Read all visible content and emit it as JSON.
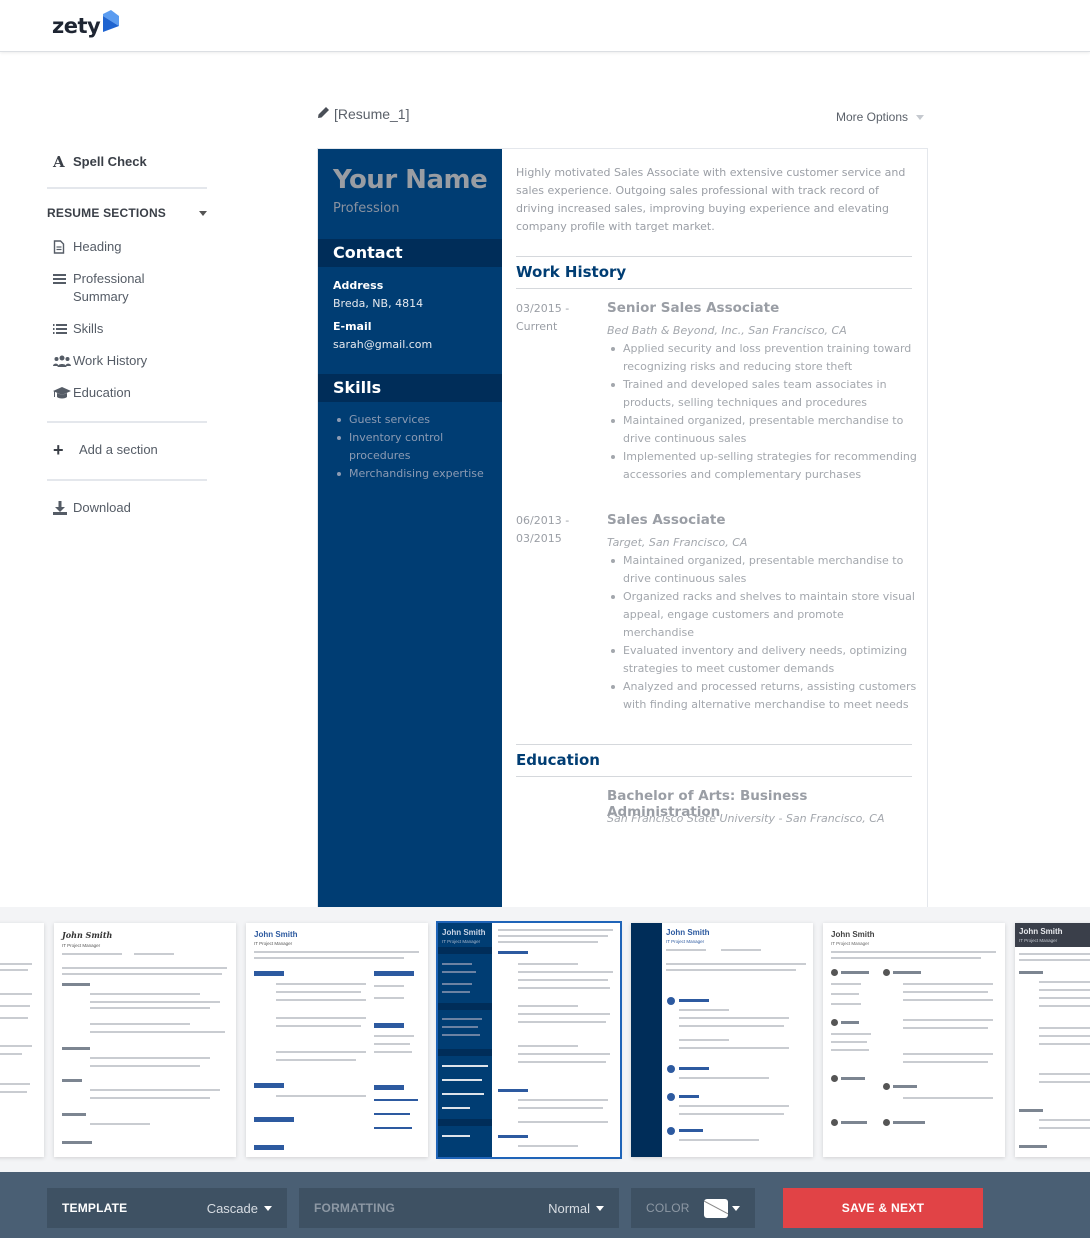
{
  "app": {
    "logo_text": "zety",
    "brand_color": "#2a7de1"
  },
  "sidebar": {
    "spell_check": "Spell Check",
    "sections_header": "RESUME SECTIONS",
    "sections": [
      {
        "label": "Heading",
        "icon": "document-icon"
      },
      {
        "label": "Professional Summary",
        "icon": "lines-icon"
      },
      {
        "label": "Skills",
        "icon": "numbered-list-icon"
      },
      {
        "label": "Work History",
        "icon": "users-icon"
      },
      {
        "label": "Education",
        "icon": "graduation-cap-icon"
      }
    ],
    "add_section": "Add a section",
    "download": "Download"
  },
  "document": {
    "title": "[Resume_1]",
    "more_options": "More Options"
  },
  "resume": {
    "accent_color": "#003d73",
    "name": "Your Name",
    "profession": "Profession",
    "contact_heading": "Contact",
    "address_label": "Address",
    "address": "Breda, NB, 4814",
    "email_label": "E-mail",
    "email": "sarah@gmail.com",
    "skills_heading": "Skills",
    "skills": [
      "Guest services",
      "Inventory control procedures",
      "Merchandising expertise"
    ],
    "summary": "Highly motivated Sales Associate with extensive customer service and sales experience. Outgoing sales professional with track record of driving increased sales, improving buying experience and elevating company profile with target market.",
    "work_heading": "Work History",
    "jobs": [
      {
        "dates": "03/2015 - Current",
        "title": "Senior Sales Associate",
        "company": "Bed Bath & Beyond, Inc., San Francisco, CA",
        "bullets": [
          "Applied security and loss prevention training toward recognizing risks and reducing store theft",
          "Trained and developed sales team associates in products, selling techniques and procedures",
          "Maintained organized, presentable merchandise to drive continuous sales",
          "Implemented up-selling strategies for recommending accessories and complementary purchases"
        ]
      },
      {
        "dates": "06/2013 - 03/2015",
        "title": "Sales Associate",
        "company": "Target, San Francisco, CA",
        "bullets": [
          "Maintained organized, presentable merchandise to drive continuous sales",
          "Organized racks and shelves to maintain store visual appeal, engage customers and promote merchandise",
          "Evaluated inventory and delivery needs, optimizing strategies to meet customer demands",
          "Analyzed and processed returns, assisting customers with finding alternative merchandise to meet needs"
        ]
      }
    ],
    "education_heading": "Education",
    "degree": "Bachelor of Arts: Business Administration",
    "school": "San Francisco State University - San Francisco, CA"
  },
  "templates": {
    "sample_name": "John Smith",
    "sample_title": "IT Project Manager",
    "items": [
      {
        "style": "partial-left",
        "selected": false
      },
      {
        "style": "script-name",
        "selected": false
      },
      {
        "style": "blue-icons",
        "selected": false
      },
      {
        "style": "cascade",
        "selected": true
      },
      {
        "style": "timeline",
        "selected": false
      },
      {
        "style": "circle-icons",
        "selected": false
      },
      {
        "style": "dark-header",
        "selected": false
      }
    ]
  },
  "toolbar": {
    "template_label": "TEMPLATE",
    "template_value": "Cascade",
    "formatting_label": "FORMATTING",
    "formatting_value": "Normal",
    "color_label": "COLOR",
    "save_label": "SAVE & NEXT",
    "save_color": "#e14346"
  }
}
